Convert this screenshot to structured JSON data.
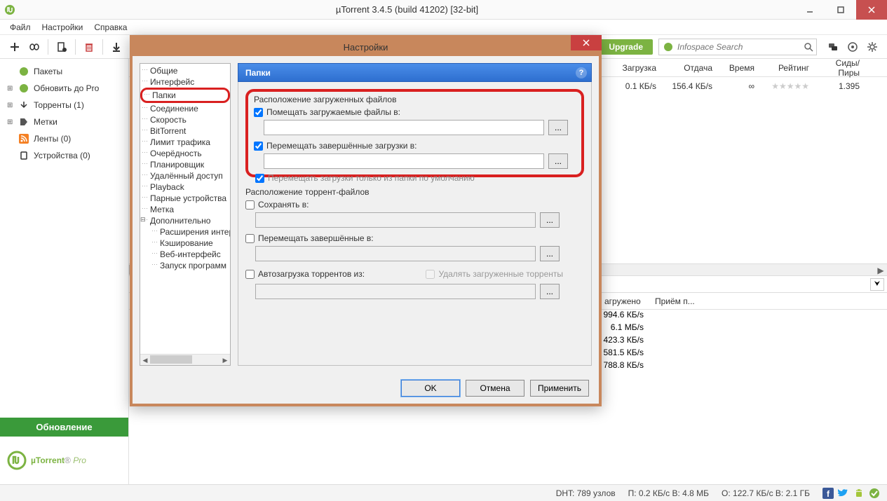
{
  "window": {
    "title": "µTorrent 3.4.5  (build 41202) [32-bit]"
  },
  "menu": {
    "file": "Файл",
    "settings": "Настройки",
    "help": "Справка"
  },
  "toolbar": {
    "upgrade": "Upgrade",
    "search_placeholder": "Infospace Search"
  },
  "sidebar": {
    "packages": "Пакеты",
    "upgrade_pro": "Обновить до Pro",
    "torrents": "Торренты (1)",
    "labels": "Метки",
    "feeds": "Ленты (0)",
    "devices": "Устройства (0)",
    "update_btn": "Обновление",
    "logo": "µTorrent",
    "logo_suffix": "Pro"
  },
  "torrent_cols": {
    "dl": "Загрузка",
    "ul": "Отдача",
    "time": "Время",
    "rating": "Рейтинг",
    "peers": "Сиды/Пиры"
  },
  "torrent_row": {
    "dl": "0.1 КБ/s",
    "ul": "156.4 КБ/s",
    "time": "∞",
    "rating": "★★★★★",
    "peers": "1.395"
  },
  "detail_cols": {
    "dl": "агружено",
    "rx": "Приём п..."
  },
  "detail_rows": [
    "994.6 КБ/s",
    "6.1 МБ/s",
    "423.3 КБ/s",
    "581.5 КБ/s",
    "788.8 КБ/s"
  ],
  "status": {
    "dht": "DHT: 789 узлов",
    "net": "П: 0.2 КБ/с В: 4.8 МБ",
    "io": "О: 122.7 КБ/с В: 2.1 ГБ"
  },
  "dialog": {
    "title": "Настройки",
    "tree": {
      "general": "Общие",
      "interface": "Интерфейс",
      "folders": "Папки",
      "connection": "Соединение",
      "speed": "Скорость",
      "bittorrent": "BitTorrent",
      "bandwidth": "Лимит трафика",
      "queue": "Очерёдность",
      "scheduler": "Планировщик",
      "remote": "Удалённый доступ",
      "playback": "Playback",
      "paired": "Парные устройства",
      "label": "Метка",
      "advanced": "Дополнительно",
      "adv_ext": "Расширения интерфейса",
      "adv_cache": "Кэширование",
      "adv_web": "Веб-интерфейс",
      "adv_run": "Запуск программ"
    },
    "panel_title": "Папки",
    "section1": "Расположение загруженных файлов",
    "chk_put_in": "Помещать загружаемые файлы в:",
    "chk_move_done": "Перемещать завершённые загрузки в:",
    "chk_move_default": "Перемещать загрузки только из папки по умолчанию",
    "section2": "Расположение торрент-файлов",
    "chk_save_in": "Сохранять в:",
    "chk_move_done2": "Перемещать завершённые в:",
    "chk_autoload": "Автозагрузка торрентов из:",
    "chk_delete_loaded": "Удалять загруженные торренты",
    "browse": "...",
    "ok": "OK",
    "cancel": "Отмена",
    "apply": "Применить"
  }
}
